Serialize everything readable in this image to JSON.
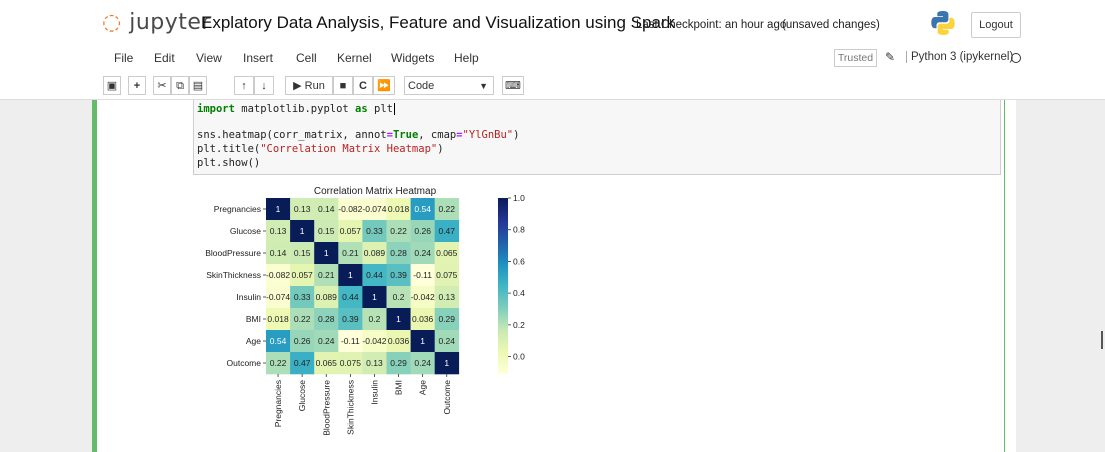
{
  "app": {
    "logo_text": "jupyter",
    "notebook_title": "Explatory Data Analysis, Feature and Visualization using Spark",
    "checkpoint": "Last Checkpoint: an hour ago",
    "unsaved": "(unsaved changes)",
    "logout_label": "Logout"
  },
  "menu": {
    "items": [
      "File",
      "Edit",
      "View",
      "Insert",
      "Cell",
      "Kernel",
      "Widgets",
      "Help"
    ],
    "trusted_label": "Trusted",
    "kernel_label": "Python 3 (ipykernel)"
  },
  "toolbar": {
    "run_label": "Run",
    "cell_type": "Code",
    "icons": [
      "save-icon",
      "plus-icon",
      "cut-icon",
      "copy-icon",
      "paste-icon",
      "arrow-up-icon",
      "arrow-down-icon",
      "run-icon",
      "stop-icon",
      "restart-icon",
      "fast-forward-icon",
      "keyboard-icon"
    ]
  },
  "code": {
    "line1_kw": "import",
    "line1_mod": " matplotlib.pyplot ",
    "line1_as": "as",
    "line1_alias": " plt",
    "line2_a": "sns.heatmap(corr_matrix, annot",
    "line2_eq1": "=",
    "line2_true": "True",
    "line2_b": ", cmap",
    "line2_eq2": "=",
    "line2_str": "\"YlGnBu\"",
    "line2_c": ")",
    "line3_a": "plt.title(",
    "line3_str": "\"Correlation Matrix Heatmap\"",
    "line3_b": ")",
    "line4": "plt.show()"
  },
  "chart_data": {
    "type": "heatmap",
    "title": "Correlation Matrix Heatmap",
    "labels": [
      "Pregnancies",
      "Glucose",
      "BloodPressure",
      "SkinThickness",
      "Insulin",
      "BMI",
      "Age",
      "Outcome"
    ],
    "matrix": [
      [
        1,
        0.13,
        0.14,
        -0.082,
        -0.074,
        0.018,
        0.54,
        0.22
      ],
      [
        0.13,
        1,
        0.15,
        0.057,
        0.33,
        0.22,
        0.26,
        0.47
      ],
      [
        0.14,
        0.15,
        1,
        0.21,
        0.089,
        0.28,
        0.24,
        0.065
      ],
      [
        -0.082,
        0.057,
        0.21,
        1,
        0.44,
        0.39,
        -0.11,
        0.075
      ],
      [
        -0.074,
        0.33,
        0.089,
        0.44,
        1,
        0.2,
        -0.042,
        0.13
      ],
      [
        0.018,
        0.22,
        0.28,
        0.39,
        0.2,
        1,
        0.036,
        0.29
      ],
      [
        0.54,
        0.26,
        0.24,
        -0.11,
        -0.042,
        0.036,
        1,
        0.24
      ],
      [
        0.22,
        0.47,
        0.065,
        0.075,
        0.13,
        0.29,
        0.24,
        1
      ]
    ],
    "cmap": "YlGnBu",
    "colorbar": {
      "min": -0.11,
      "max": 1.0,
      "ticks": [
        0.0,
        0.2,
        0.4,
        0.6,
        0.8,
        1.0
      ],
      "tick_labels": [
        "0.0",
        "0.2",
        "0.4",
        "0.6",
        "0.8",
        "1.0"
      ]
    }
  }
}
